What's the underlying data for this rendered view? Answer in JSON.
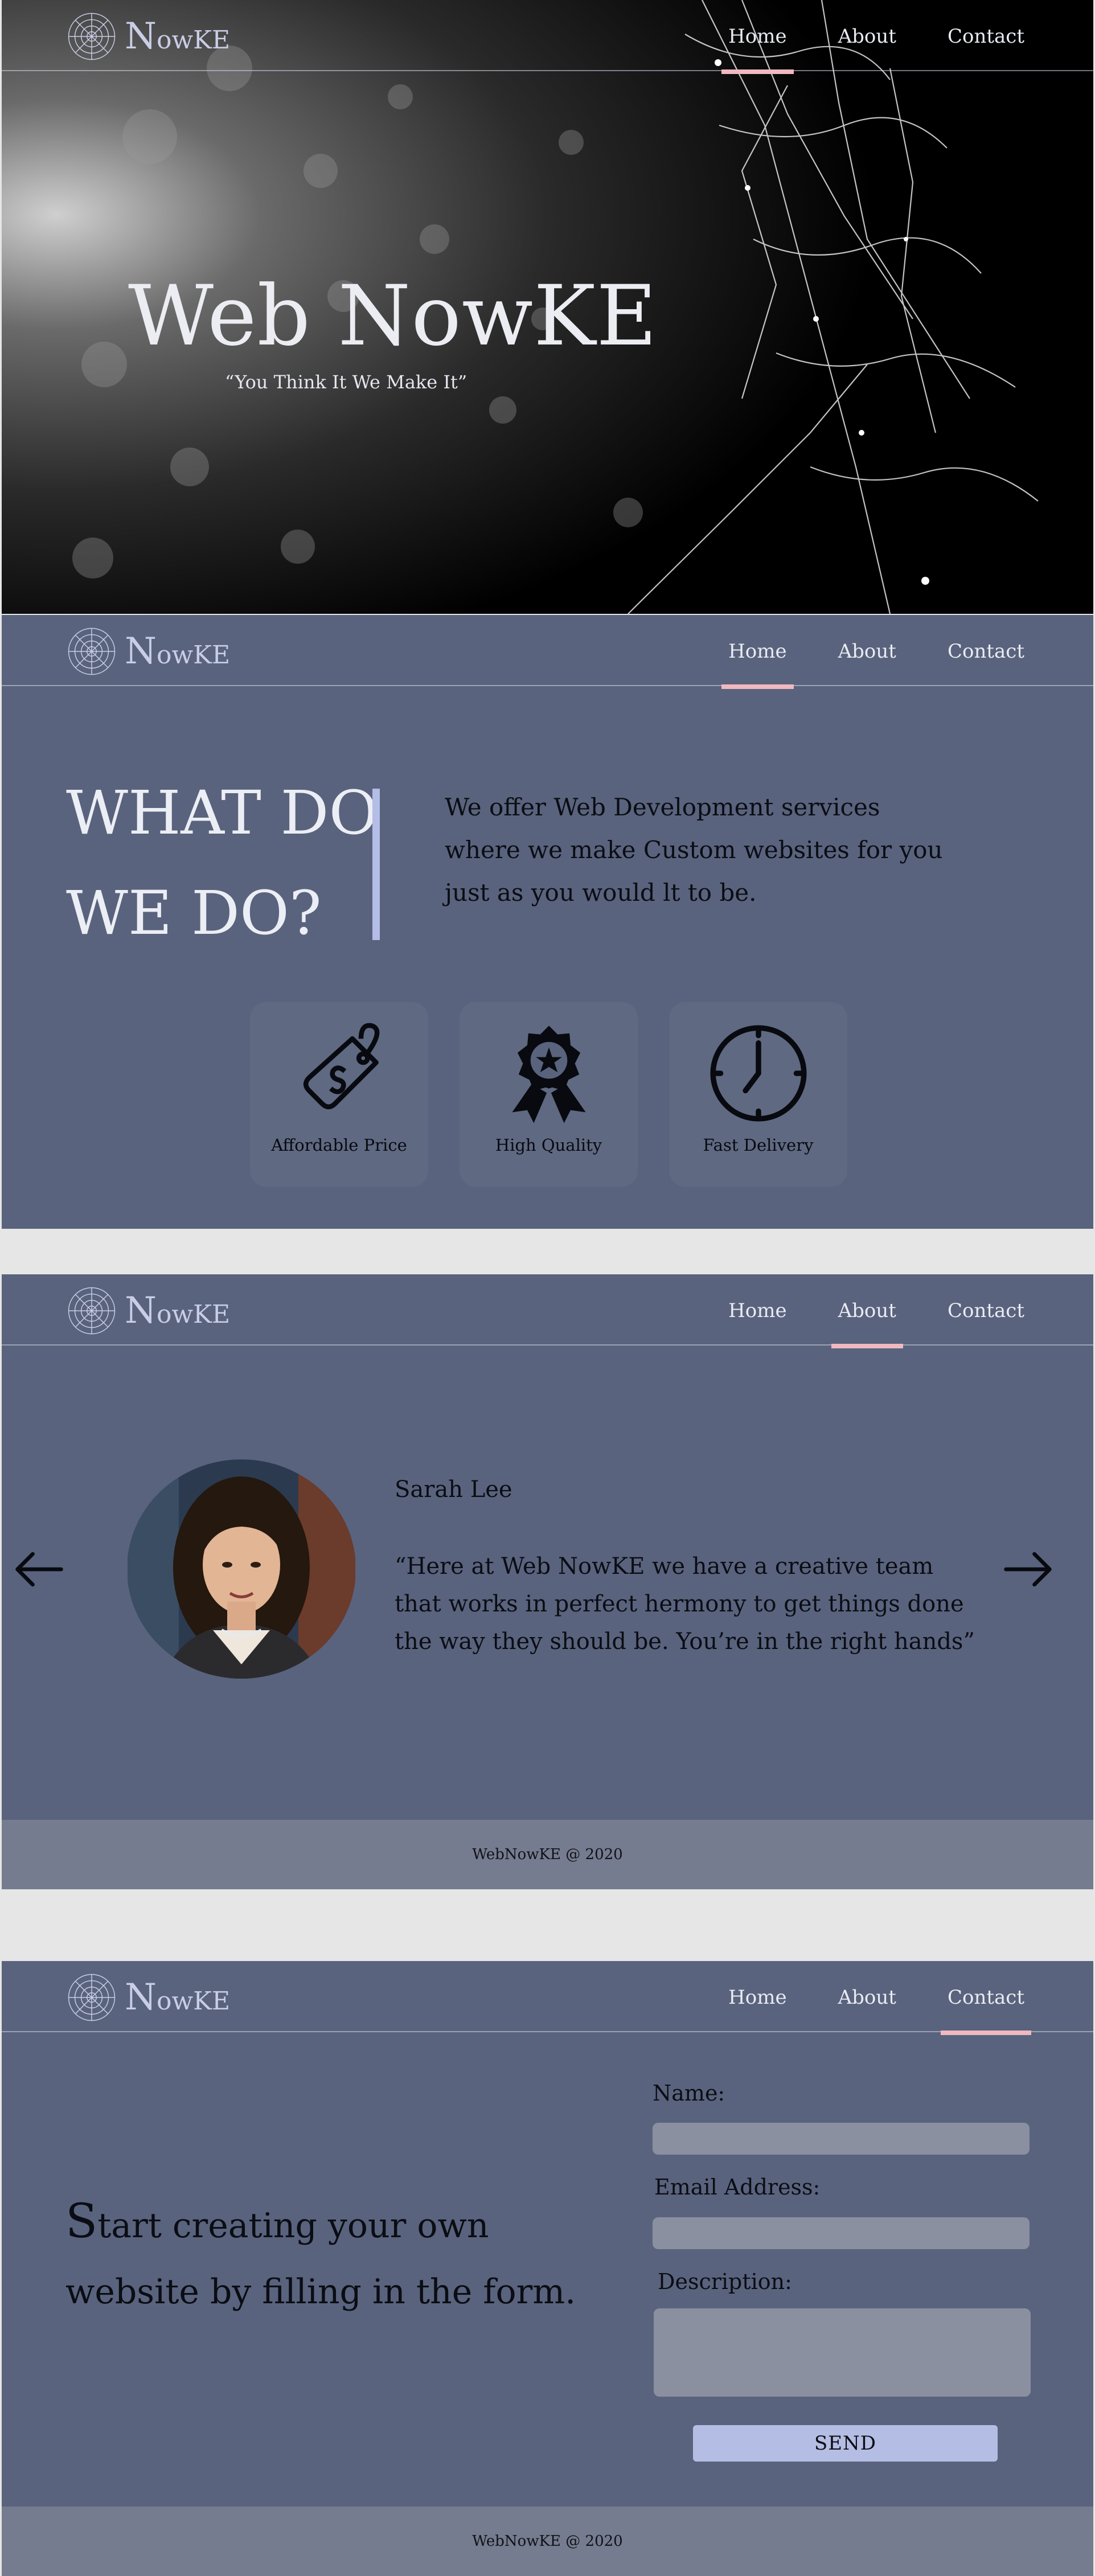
{
  "brand": {
    "logo_initial": "N",
    "logo_rest": "owKE"
  },
  "nav": {
    "home": "Home",
    "about": "About",
    "contact": "Contact"
  },
  "hero": {
    "title": "Web NowKE",
    "tagline": "“You Think It We Make It”"
  },
  "services": {
    "heading_line1": "WHAT DO",
    "heading_line2": "WE DO?",
    "description": "We offer Web Development services where we make Custom websites for you just as you would lt to be.",
    "cards": [
      {
        "label": "Affordable Price",
        "icon": "price-tag-icon"
      },
      {
        "label": "High Quality",
        "icon": "award-ribbon-icon"
      },
      {
        "label": "Fast Delivery",
        "icon": "clock-icon"
      }
    ]
  },
  "testimonial": {
    "name": "Sarah Lee",
    "quote": "“Here at Web NowKE we have a creative team that works in perfect hermony to get things done the way they should be. You’re in the right hands”"
  },
  "footer": {
    "text": "WebNowKE @ 2020"
  },
  "contact": {
    "heading_cap": "S",
    "heading_rest": "tart creating your own",
    "heading_line2": "website by filling in the form.",
    "name_label": "Name:",
    "email_label": "Email Address:",
    "description_label": "Description:",
    "send_label": "SEND"
  },
  "colors": {
    "section_bg": "#59637d",
    "active_underline": "#f0b9bf",
    "accent": "#b4bde6",
    "footer_bg": "#767c8f",
    "field_bg": "#8a909f"
  }
}
